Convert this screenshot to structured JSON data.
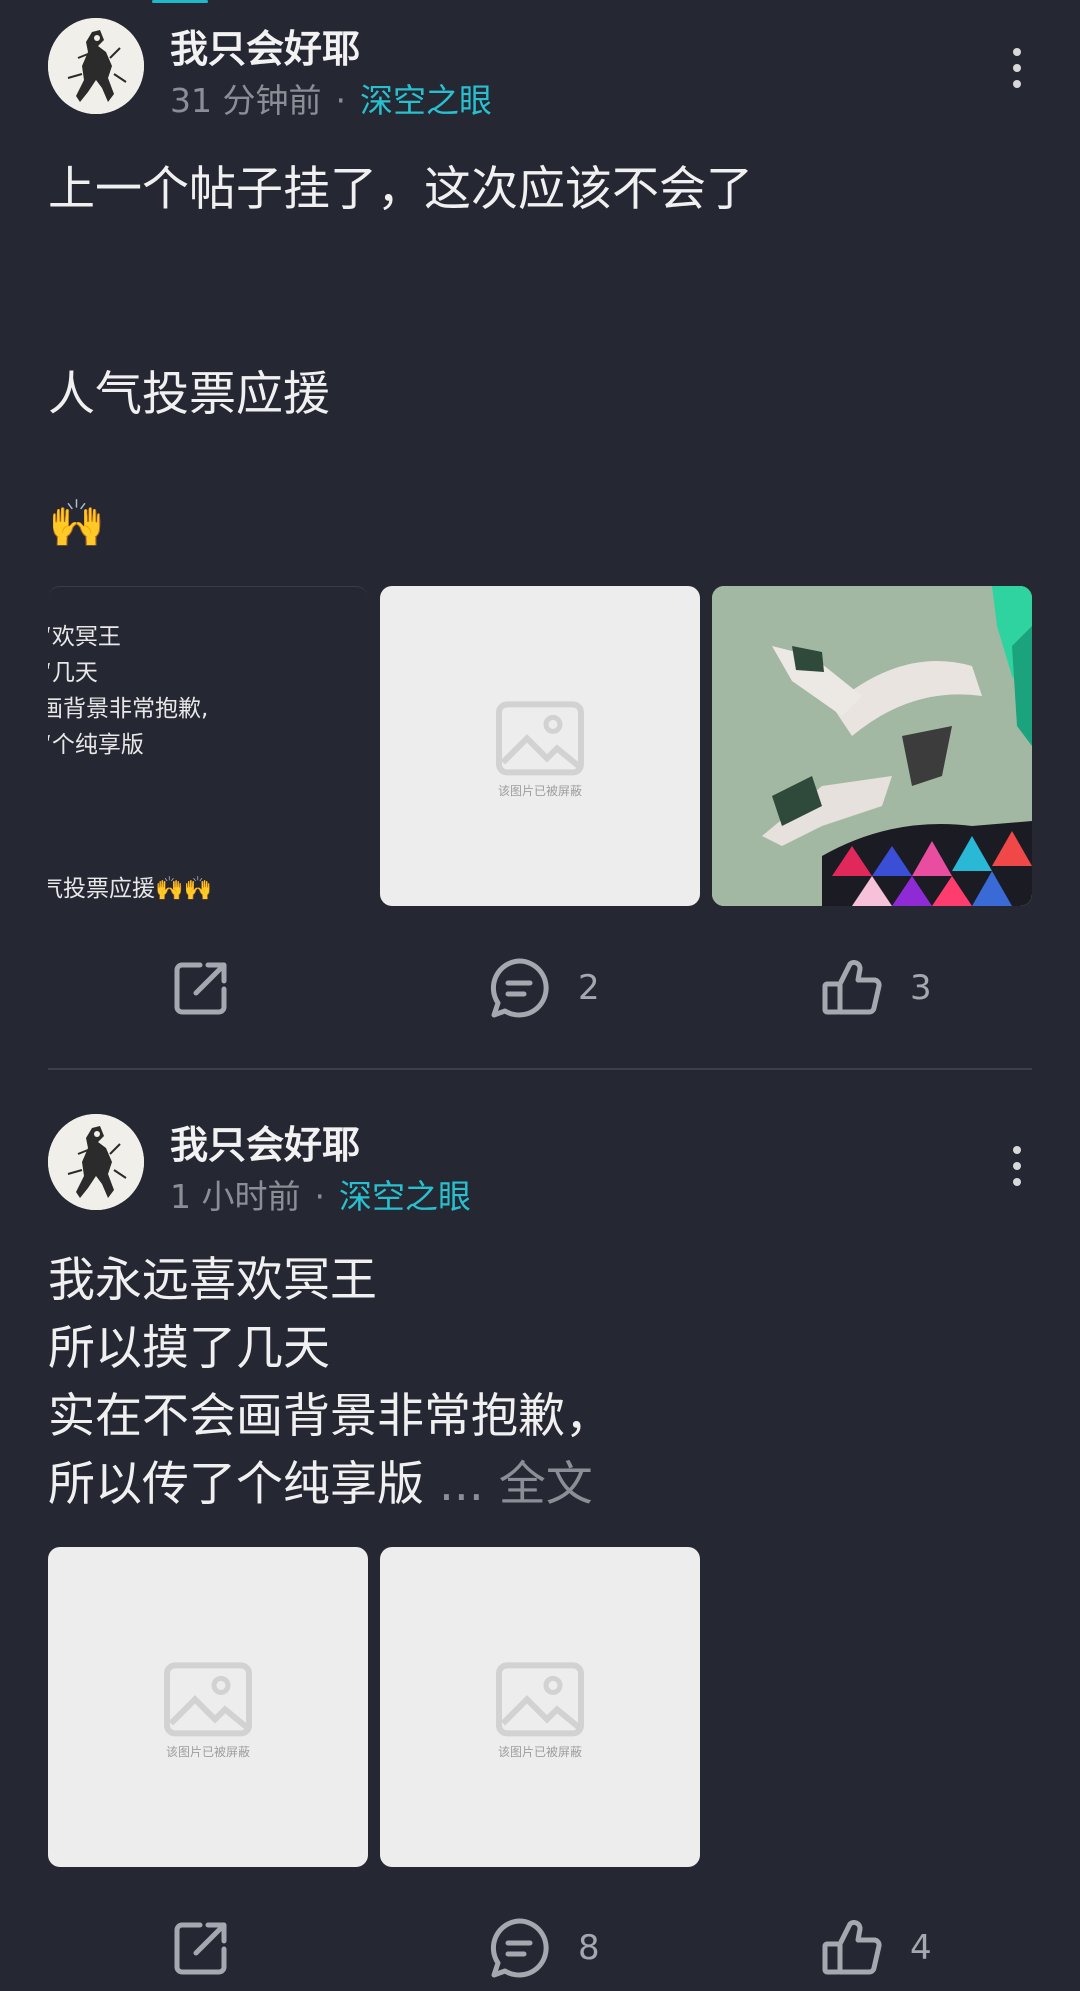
{
  "posts": [
    {
      "username": "我只会好耶",
      "time": "31 分钟前",
      "separator": "·",
      "topic": "深空之眼",
      "lines": [
        "上一个帖子挂了，这次应该不会了",
        "人气投票应援",
        "🙌"
      ],
      "text_image_lines": [
        "“欢冥王",
        "“几天",
        "画背景非常抱歉,",
        "“个纯享版",
        "气投票应援🙌🙌"
      ],
      "blocked_image_text": "该图片已被屏蔽",
      "actions": {
        "comments": "2",
        "likes": "3"
      }
    },
    {
      "username": "我只会好耶",
      "time": "1 小时前",
      "separator": "·",
      "topic": "深空之眼",
      "lines": [
        "我永远喜欢冥王",
        "所以摸了几天",
        "实在不会画背景非常抱歉，",
        "所以传了个纯享版"
      ],
      "ellipsis": " ... ",
      "full_text_link": "全文",
      "blocked_image_text": "该图片已被屏蔽",
      "actions": {
        "comments": "8",
        "likes": "4"
      }
    }
  ],
  "icons": [
    "more-vertical-icon",
    "share-icon",
    "comment-icon",
    "like-icon",
    "image-placeholder-icon"
  ],
  "colors": {
    "background": "#252733",
    "accent": "#28c0cf",
    "muted": "#8c8e96"
  }
}
